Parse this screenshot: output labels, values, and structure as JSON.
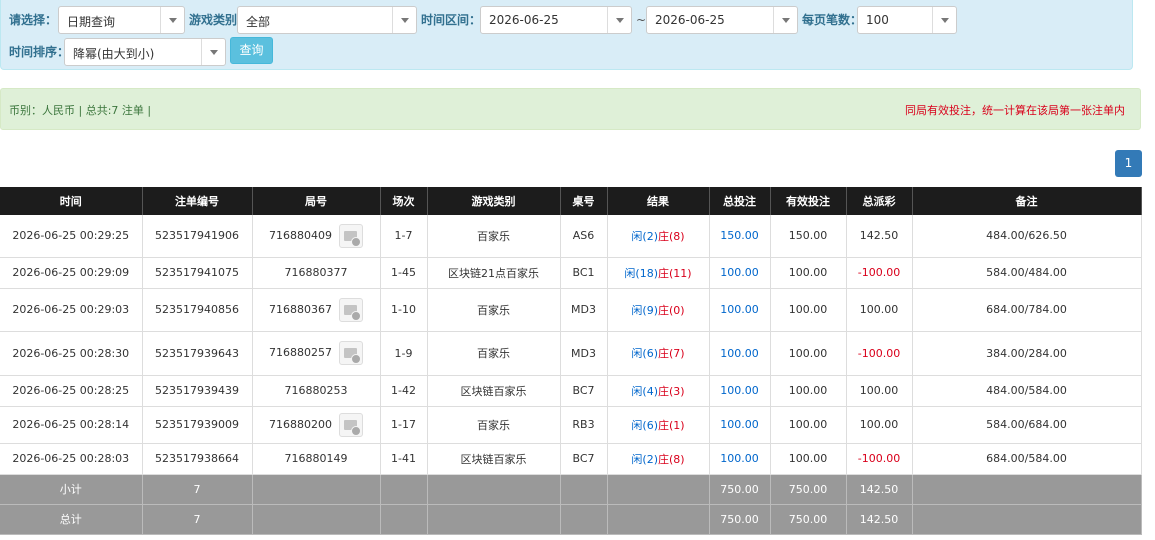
{
  "filters": {
    "select_label": "请选择：",
    "select_value": "日期查询",
    "game_type_label": "游戏类别",
    "game_type_value": "全部",
    "range_label": "时间区间：",
    "date_from": "2026-06-25",
    "range_sep": "~",
    "date_to": "2026-06-25",
    "per_page_label": "每页笔数：",
    "per_page_value": "100",
    "sort_label": "时间排序：",
    "sort_value": "降幂(由大到小)",
    "query_button": "查询"
  },
  "summary": {
    "left": "币别：人民币 | 总共:7 注单 |",
    "right": "同局有效投注，统一计算在该局第一张注单内"
  },
  "pagination": {
    "current": "1"
  },
  "table": {
    "headers": [
      "时间",
      "注单编号",
      "局号",
      "场次",
      "游戏类别",
      "桌号",
      "结果",
      "总投注",
      "有效投注",
      "总派彩",
      "备注"
    ],
    "rows": [
      {
        "time": "2026-06-25 00:29:25",
        "order": "523517941906",
        "round": "716880409",
        "session": "1-7",
        "game": "百家乐",
        "table": "AS6",
        "result_player": "闲(2)",
        "result_banker": "庄(8)",
        "bet": "150.00",
        "valid": "150.00",
        "payout": "142.50",
        "note": "484.00/626.50"
      },
      {
        "time": "2026-06-25 00:29:09",
        "order": "523517941075",
        "round": "716880377",
        "session": "1-45",
        "game": "区块链21点百家乐",
        "table": "BC1",
        "result_player": "闲(18)",
        "result_banker": "庄(11)",
        "bet": "100.00",
        "valid": "100.00",
        "payout": "-100.00",
        "note": "584.00/484.00"
      },
      {
        "time": "2026-06-25 00:29:03",
        "order": "523517940856",
        "round": "716880367",
        "session": "1-10",
        "game": "百家乐",
        "table": "MD3",
        "result_player": "闲(9)",
        "result_banker": "庄(0)",
        "bet": "100.00",
        "valid": "100.00",
        "payout": "100.00",
        "note": "684.00/784.00"
      },
      {
        "time": "2026-06-25 00:28:30",
        "order": "523517939643",
        "round": "716880257",
        "session": "1-9",
        "game": "百家乐",
        "table": "MD3",
        "result_player": "闲(6)",
        "result_banker": "庄(7)",
        "bet": "100.00",
        "valid": "100.00",
        "payout": "-100.00",
        "note": "384.00/284.00"
      },
      {
        "time": "2026-06-25 00:28:25",
        "order": "523517939439",
        "round": "716880253",
        "session": "1-42",
        "game": "区块链百家乐",
        "table": "BC7",
        "result_player": "闲(4)",
        "result_banker": "庄(3)",
        "bet": "100.00",
        "valid": "100.00",
        "payout": "100.00",
        "note": "484.00/584.00"
      },
      {
        "time": "2026-06-25 00:28:14",
        "order": "523517939009",
        "round": "716880200",
        "session": "1-17",
        "game": "百家乐",
        "table": "RB3",
        "result_player": "闲(6)",
        "result_banker": "庄(1)",
        "bet": "100.00",
        "valid": "100.00",
        "payout": "100.00",
        "note": "584.00/684.00"
      },
      {
        "time": "2026-06-25 00:28:03",
        "order": "523517938664",
        "round": "716880149",
        "session": "1-41",
        "game": "区块链百家乐",
        "table": "BC7",
        "result_player": "闲(2)",
        "result_banker": "庄(8)",
        "bet": "100.00",
        "valid": "100.00",
        "payout": "-100.00",
        "note": "684.00/584.00"
      }
    ],
    "subtotal": {
      "label": "小计",
      "count": "7",
      "bet": "750.00",
      "valid": "750.00",
      "payout": "142.50"
    },
    "total": {
      "label": "总计",
      "count": "7",
      "bet": "750.00",
      "valid": "750.00",
      "payout": "142.50"
    }
  },
  "colors": {
    "player": "#0066cc",
    "banker": "#d9001b",
    "header_bg": "#1c1c1c",
    "total_bg": "#999999"
  },
  "icons": {
    "replay": "video-replay-icon"
  }
}
